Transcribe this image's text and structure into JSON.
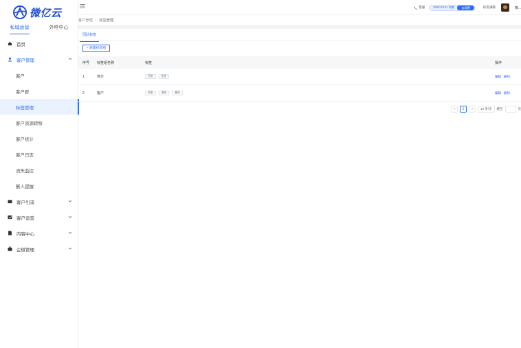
{
  "brand": {
    "name": "微亿云",
    "accent": "#2d6cf6"
  },
  "sidebar": {
    "tabs": [
      {
        "label": "私域运营",
        "active": true
      },
      {
        "label": "外呼中心",
        "active": false
      }
    ],
    "menu": [
      {
        "label": "首页",
        "icon": "home-icon"
      },
      {
        "label": "客户管理",
        "icon": "user-icon",
        "open": true,
        "children": [
          "客户",
          "客户群",
          "标签管理",
          "客户资源转移",
          "客户统计",
          "客户日志",
          "流失监控",
          "删人提醒"
        ],
        "active_child": "标签管理"
      },
      {
        "label": "客户引流",
        "icon": "folder-icon"
      },
      {
        "label": "客户运营",
        "icon": "chart-icon"
      },
      {
        "label": "内容中心",
        "icon": "document-icon"
      },
      {
        "label": "企微管理",
        "icon": "briefcase-icon"
      }
    ]
  },
  "topbar": {
    "phone": "客服",
    "date": "2023-03-21 到期",
    "renew": "去续费",
    "stat": "好友满额",
    "user": "微..."
  },
  "breadcrumb": [
    "客户管理",
    "标签管理"
  ],
  "content": {
    "tab": "团队标签",
    "add_button": "+ 新建标签组",
    "table": {
      "headers": {
        "no": "序号",
        "name": "标签组名称",
        "tags": "标签",
        "actions": "操作"
      },
      "rows": [
        {
          "no": "1",
          "name": "地方",
          "tags": [
            "河北",
            "北京"
          ],
          "edit": "编辑",
          "delete": "删除"
        },
        {
          "no": "2",
          "name": "客户",
          "tags": [
            "开发",
            "流失",
            "意向"
          ],
          "edit": "编辑",
          "delete": "删除"
        }
      ]
    },
    "pagination": {
      "prev": "<",
      "current": "1",
      "next": ">",
      "page_size": "10 条/页",
      "goto": "跳至",
      "page_unit": "页"
    }
  }
}
